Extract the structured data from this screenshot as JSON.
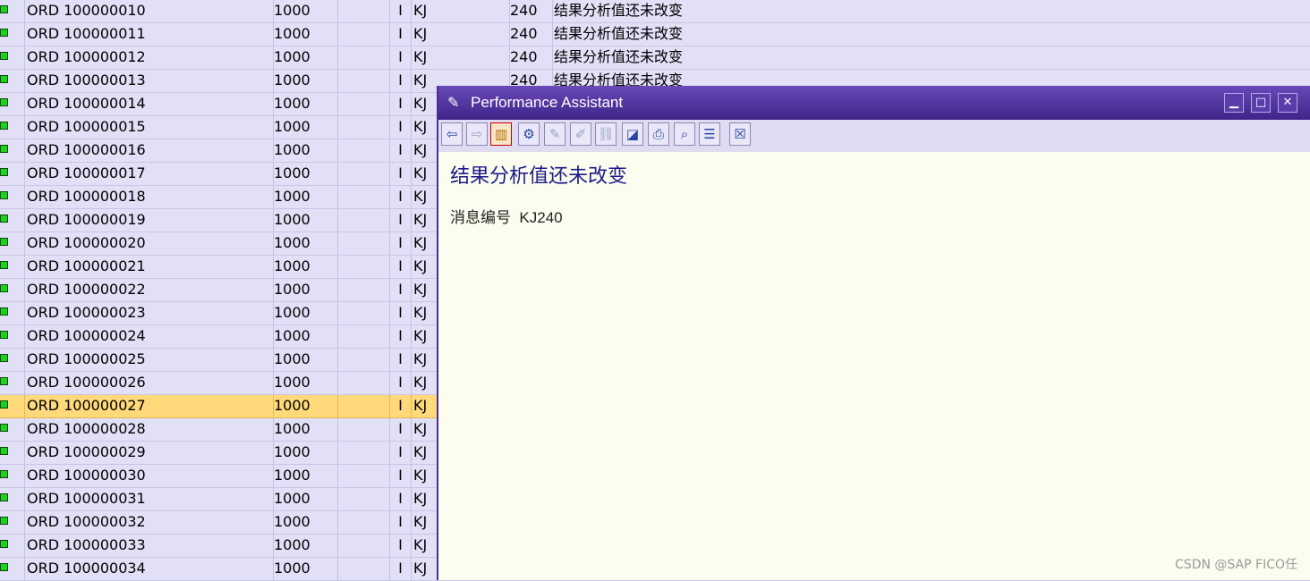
{
  "rows": [
    {
      "object": "ORD 100000010",
      "qty": "1000",
      "type": "I",
      "cls": "KJ",
      "num": "240",
      "text": "结果分析值还未改变"
    },
    {
      "object": "ORD 100000011",
      "qty": "1000",
      "type": "I",
      "cls": "KJ",
      "num": "240",
      "text": "结果分析值还未改变"
    },
    {
      "object": "ORD 100000012",
      "qty": "1000",
      "type": "I",
      "cls": "KJ",
      "num": "240",
      "text": "结果分析值还未改变"
    },
    {
      "object": "ORD 100000013",
      "qty": "1000",
      "type": "I",
      "cls": "KJ",
      "num": "240",
      "text": "结果分析值还未改变"
    },
    {
      "object": "ORD 100000014",
      "qty": "1000",
      "type": "I",
      "cls": "KJ",
      "num": "",
      "text": ""
    },
    {
      "object": "ORD 100000015",
      "qty": "1000",
      "type": "I",
      "cls": "KJ",
      "num": "",
      "text": ""
    },
    {
      "object": "ORD 100000016",
      "qty": "1000",
      "type": "I",
      "cls": "KJ",
      "num": "",
      "text": ""
    },
    {
      "object": "ORD 100000017",
      "qty": "1000",
      "type": "I",
      "cls": "KJ",
      "num": "",
      "text": ""
    },
    {
      "object": "ORD 100000018",
      "qty": "1000",
      "type": "I",
      "cls": "KJ",
      "num": "",
      "text": ""
    },
    {
      "object": "ORD 100000019",
      "qty": "1000",
      "type": "I",
      "cls": "KJ",
      "num": "",
      "text": ""
    },
    {
      "object": "ORD 100000020",
      "qty": "1000",
      "type": "I",
      "cls": "KJ",
      "num": "",
      "text": ""
    },
    {
      "object": "ORD 100000021",
      "qty": "1000",
      "type": "I",
      "cls": "KJ",
      "num": "",
      "text": ""
    },
    {
      "object": "ORD 100000022",
      "qty": "1000",
      "type": "I",
      "cls": "KJ",
      "num": "",
      "text": ""
    },
    {
      "object": "ORD 100000023",
      "qty": "1000",
      "type": "I",
      "cls": "KJ",
      "num": "",
      "text": ""
    },
    {
      "object": "ORD 100000024",
      "qty": "1000",
      "type": "I",
      "cls": "KJ",
      "num": "",
      "text": ""
    },
    {
      "object": "ORD 100000025",
      "qty": "1000",
      "type": "I",
      "cls": "KJ",
      "num": "",
      "text": ""
    },
    {
      "object": "ORD 100000026",
      "qty": "1000",
      "type": "I",
      "cls": "KJ",
      "num": "",
      "text": ""
    },
    {
      "object": "ORD 100000027",
      "qty": "1000",
      "type": "I",
      "cls": "KJ",
      "num": "",
      "text": "",
      "selected": true
    },
    {
      "object": "ORD 100000028",
      "qty": "1000",
      "type": "I",
      "cls": "KJ",
      "num": "",
      "text": ""
    },
    {
      "object": "ORD 100000029",
      "qty": "1000",
      "type": "I",
      "cls": "KJ",
      "num": "",
      "text": ""
    },
    {
      "object": "ORD 100000030",
      "qty": "1000",
      "type": "I",
      "cls": "KJ",
      "num": "",
      "text": ""
    },
    {
      "object": "ORD 100000031",
      "qty": "1000",
      "type": "I",
      "cls": "KJ",
      "num": "",
      "text": ""
    },
    {
      "object": "ORD 100000032",
      "qty": "1000",
      "type": "I",
      "cls": "KJ",
      "num": "",
      "text": ""
    },
    {
      "object": "ORD 100000033",
      "qty": "1000",
      "type": "I",
      "cls": "KJ",
      "num": "",
      "text": ""
    },
    {
      "object": "ORD 100000034",
      "qty": "1000",
      "type": "I",
      "cls": "KJ",
      "num": "",
      "text": ""
    }
  ],
  "status_led_color": "#1fd11f",
  "popup": {
    "title": "Performance Assistant",
    "title_icon": "pencil-document-icon",
    "window_buttons": {
      "minimize": "minimize-icon",
      "maximize": "maximize-icon",
      "close": "close-icon"
    },
    "toolbar": [
      {
        "icon": "back-arrow-icon",
        "glyph": "⇦"
      },
      {
        "icon": "forward-arrow-icon",
        "glyph": "⇨",
        "disabled": true
      },
      {
        "icon": "book-icon",
        "glyph": "▥",
        "highlighted": true
      },
      {
        "icon": "technical-info-icon",
        "glyph": "⚙"
      },
      {
        "icon": "edit-icon",
        "glyph": "✎",
        "disabled": true
      },
      {
        "icon": "edit-pencil-icon",
        "glyph": "✐",
        "disabled": true
      },
      {
        "icon": "link-icon",
        "glyph": "⛓",
        "disabled": true
      },
      {
        "icon": "bookmark-icon",
        "glyph": "◪"
      },
      {
        "icon": "print-icon",
        "glyph": "⎙"
      },
      {
        "icon": "find-icon",
        "glyph": "⌕"
      },
      {
        "icon": "notes-icon",
        "glyph": "☰"
      },
      {
        "icon": "exit-icon",
        "glyph": "☒"
      }
    ],
    "message_title": "结果分析值还未改变",
    "message_number_label": "消息编号",
    "message_number": "KJ240"
  },
  "watermark": "CSDN @SAP FICO任"
}
